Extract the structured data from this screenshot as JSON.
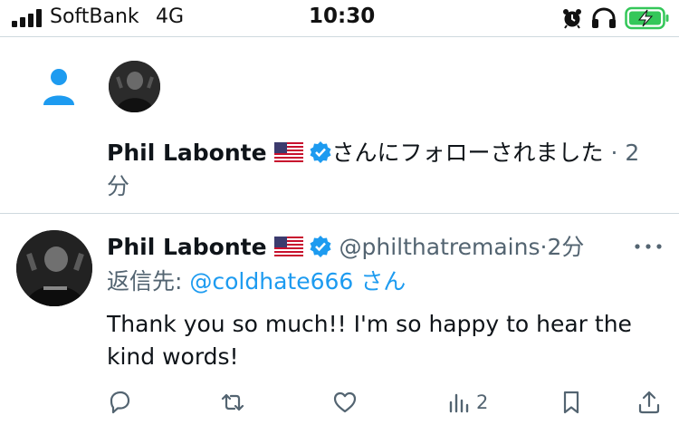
{
  "status_bar": {
    "carrier": "SoftBank",
    "network": "4G",
    "time": "10:30"
  },
  "notification": {
    "user_name": "Phil Labonte",
    "message": "さんにフォローされました",
    "separator": "·",
    "time": "2分"
  },
  "reply": {
    "user_name": "Phil Labonte",
    "handle": "@philthatremains",
    "separator": "·",
    "time": "2分",
    "reply_to_prefix": "返信先:",
    "reply_to_handle": "@coldhate666",
    "reply_to_suffix": "さん",
    "body": "Thank you so much!! I'm so happy to hear the kind words!",
    "actions": {
      "views_count": "2"
    }
  },
  "colors": {
    "accent": "#1d9bf0",
    "muted": "#536471",
    "text": "#0f1419",
    "battery": "#34c759"
  },
  "icons": {
    "follow": "person-icon",
    "verified": "verified-badge-icon",
    "flag": "us-flag-icon",
    "more": "more-icon",
    "reply": "reply-icon",
    "retweet": "retweet-icon",
    "like": "heart-icon",
    "views": "views-icon",
    "bookmark": "bookmark-icon",
    "share": "share-icon"
  }
}
